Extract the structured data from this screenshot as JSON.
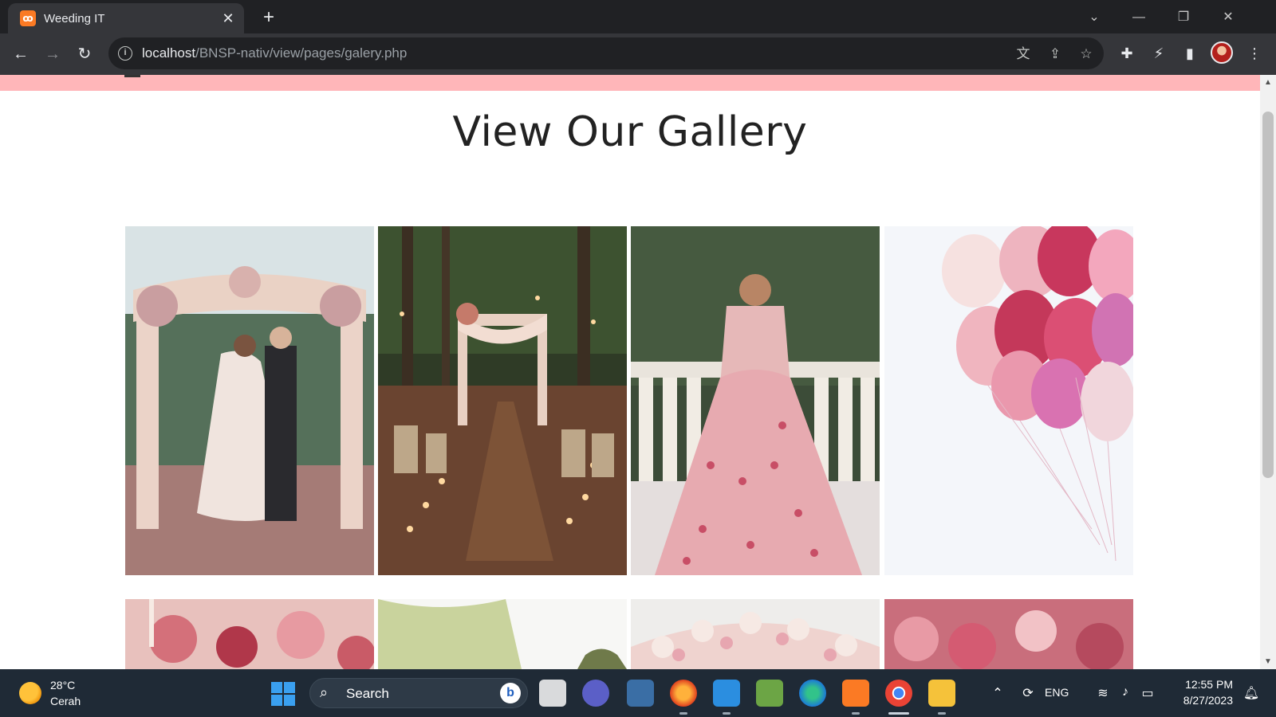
{
  "browser": {
    "tab_title": "Weeding IT",
    "favicon_text": "ꝏ",
    "url_host": "localhost",
    "url_path": "/BNSP-nativ/view/pages/galery.php"
  },
  "page": {
    "title": "View Our Gallery",
    "header_bar_color": "#ffb6b9"
  },
  "gallery": {
    "images": [
      {
        "name": "wedding-couple-on-pier-photo",
        "caption": ""
      },
      {
        "name": "forest-wedding-arch-photo",
        "caption": ""
      },
      {
        "name": "bride-pink-lehenga-photo",
        "caption": ""
      },
      {
        "name": "pink-balloons-photo",
        "caption": ""
      },
      {
        "name": "pink-table-flowers-photo",
        "caption": ""
      },
      {
        "name": "willow-tree-photo",
        "caption": ""
      },
      {
        "name": "floral-arch-photo",
        "caption": ""
      },
      {
        "name": "pink-flower-decor-photo",
        "caption": ""
      }
    ]
  },
  "taskbar": {
    "weather_temp": "28°C",
    "weather_desc": "Cerah",
    "search_label": "Search",
    "language": "ENG",
    "time": "12:55 PM",
    "date": "8/27/2023"
  },
  "colors": {
    "accent_pink": "#ffb6b9",
    "chrome_dark": "#202124",
    "taskbar_bg": "#1f2a36"
  }
}
